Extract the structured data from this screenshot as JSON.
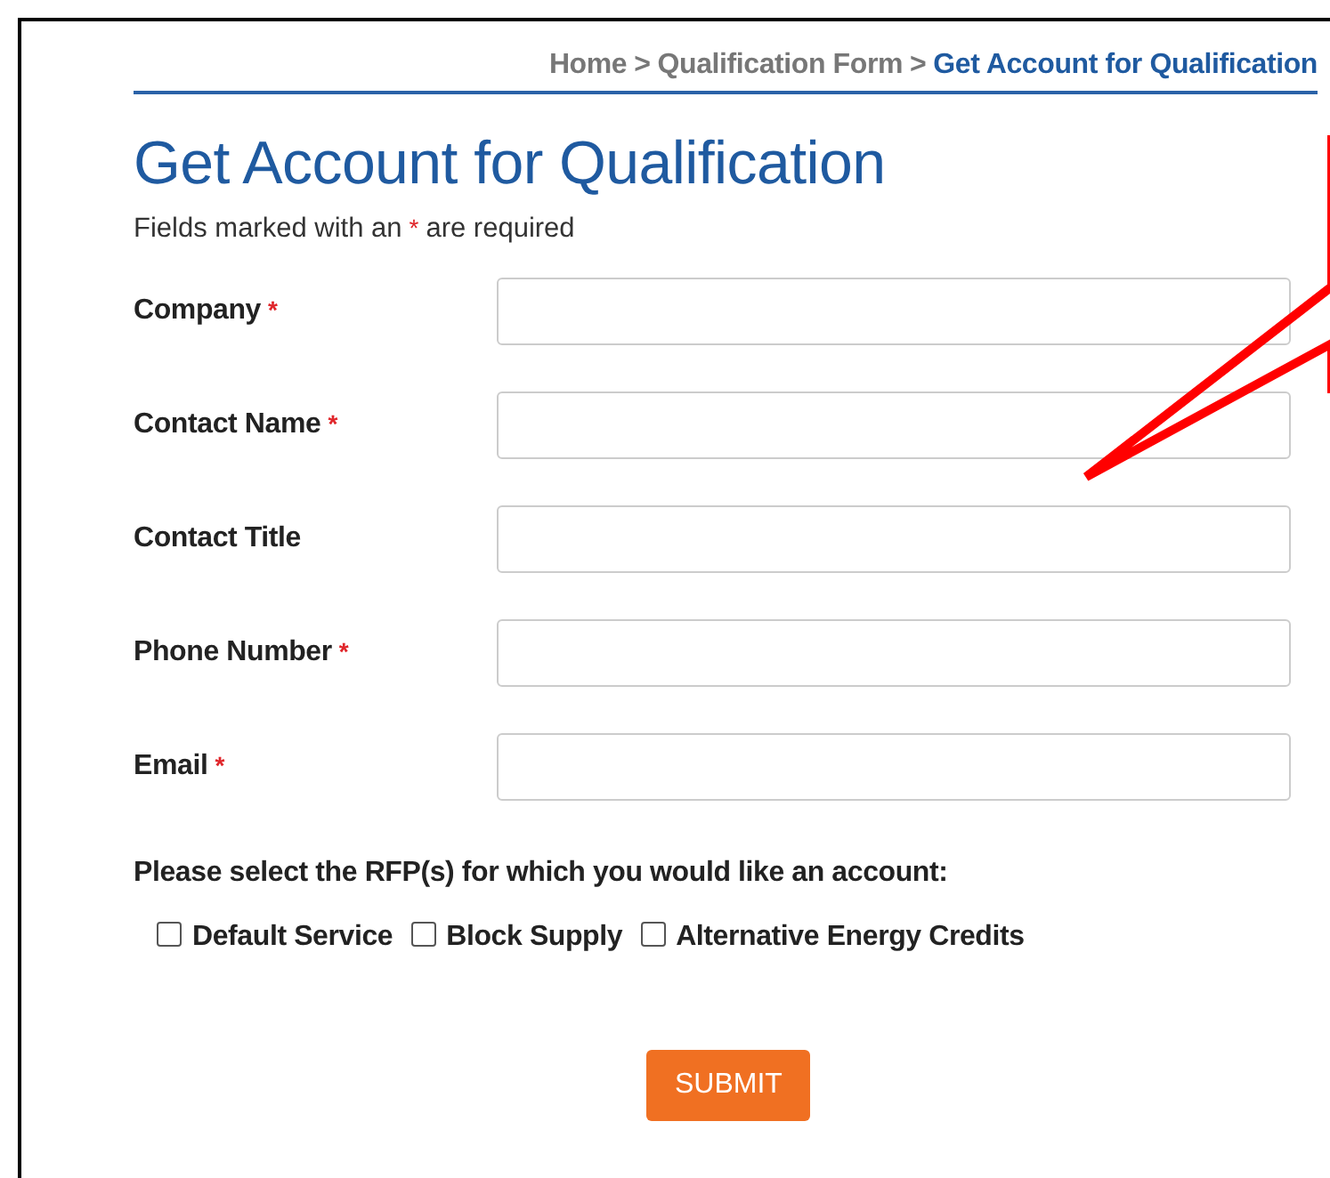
{
  "breadcrumb": [
    {
      "label": "Home",
      "current": false
    },
    {
      "label": "Qualification Form",
      "current": false
    },
    {
      "label": "Get Account for Qualification",
      "current": true
    }
  ],
  "breadcrumb_separator": ">",
  "title": "Get Account for Qualification",
  "required_note": {
    "before": "Fields marked with an",
    "mark": "*",
    "after": "are required"
  },
  "fields": [
    {
      "label": "Company",
      "required_mark": "*"
    },
    {
      "label": "Contact Name",
      "required_mark": "*"
    },
    {
      "label": "Contact Title"
    },
    {
      "label": "Phone Number",
      "required_mark": "*"
    },
    {
      "label": "Email",
      "required_mark": "*"
    }
  ],
  "rfp_prompt": "Please select the RFP(s) for which you would like an account:",
  "rfp_options": [
    {
      "label": "Default Service",
      "checked": false
    },
    {
      "label": "Block Supply",
      "checked": false
    },
    {
      "label": "Alternative Energy Credits",
      "checked": false
    }
  ],
  "submit": "SUBMIT"
}
